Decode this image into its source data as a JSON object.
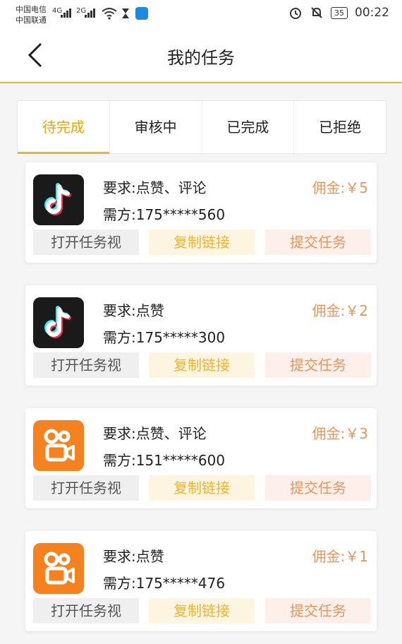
{
  "status": {
    "carrier1": "中国电信",
    "carrier2": "中国联通",
    "net1": "4G",
    "net2": "2G",
    "battery": "35",
    "time": "00:22"
  },
  "header": {
    "title": "我的任务"
  },
  "tabs": [
    {
      "label": "待完成"
    },
    {
      "label": "审核中"
    },
    {
      "label": "已完成"
    },
    {
      "label": "已拒绝"
    }
  ],
  "tasks": [
    {
      "app": "tiktok",
      "requirement": "要求:点赞、评论",
      "publisher": "需方:175*****560",
      "fee": "佣金:￥5",
      "open": "打开任务视",
      "copy": "复制链接",
      "submit": "提交任务"
    },
    {
      "app": "tiktok",
      "requirement": "要求:点赞",
      "publisher": "需方:175*****300",
      "fee": "佣金:￥2",
      "open": "打开任务视",
      "copy": "复制链接",
      "submit": "提交任务"
    },
    {
      "app": "kuaishou",
      "requirement": "要求:点赞、评论",
      "publisher": "需方:151*****600",
      "fee": "佣金:￥3",
      "open": "打开任务视",
      "copy": "复制链接",
      "submit": "提交任务"
    },
    {
      "app": "kuaishou",
      "requirement": "要求:点赞",
      "publisher": "需方:175*****476",
      "fee": "佣金:￥1",
      "open": "打开任务视",
      "copy": "复制链接",
      "submit": "提交任务"
    }
  ],
  "icons": {
    "back": "chevron-left-icon",
    "tiktok": "tiktok-logo-icon",
    "kuaishou": "kuaishou-logo-icon",
    "wifi": "wifi-icon",
    "alarm": "alarm-icon",
    "mute": "bell-off-icon"
  },
  "colors": {
    "accent": "#f2b233",
    "fee": "#e8965a",
    "kuaishou": "#f5821f",
    "tiktok": "#1a1a1a"
  }
}
